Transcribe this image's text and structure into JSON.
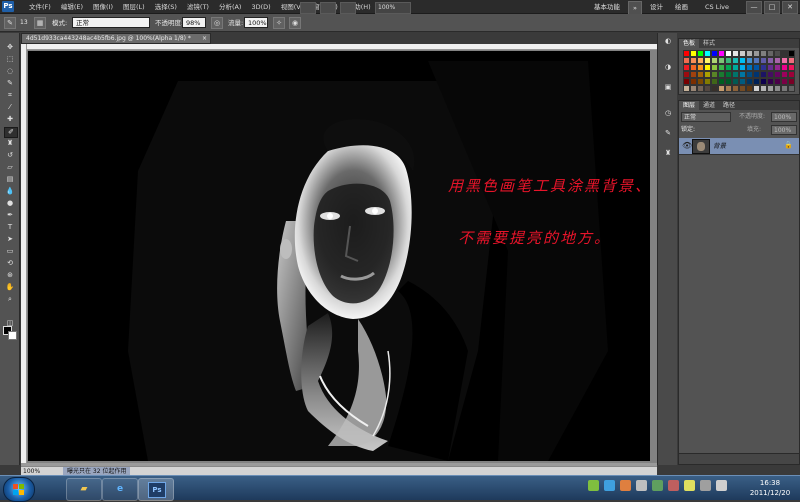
{
  "menubar": {
    "app_icon": "Ps",
    "menus": [
      "文件(F)",
      "编辑(E)",
      "图像(I)",
      "图层(L)",
      "选择(S)",
      "滤镜(T)",
      "分析(A)",
      "3D(D)",
      "视图(V)",
      "窗口(W)",
      "帮助(H)"
    ],
    "zoom": "100%",
    "workspaces": [
      "基本功能",
      "设计",
      "绘画"
    ],
    "workspace_more": "»",
    "cs_live": "CS Live",
    "window_buttons": [
      "—",
      "□",
      "✕"
    ]
  },
  "options": {
    "mode_label": "模式:",
    "mode_value": "正常",
    "opacity_label": "不透明度:",
    "opacity_value": "98%",
    "flow_label": "流量:",
    "flow_value": "100%",
    "brush_size": "13"
  },
  "document": {
    "tab_title": "4d51d933ca443248ac4b5fb6.jpg @ 100%(Alpha 1/8) *",
    "close": "×",
    "status_zoom": "100%",
    "status_text": "曝光只在 32 位起作用"
  },
  "canvas": {
    "annotation_line1": "用黑色画笔工具涂黑背景、服装等",
    "annotation_line2": "不需要提亮的地方。"
  },
  "panels": {
    "swatches_tabs": [
      "色板",
      "样式"
    ],
    "layers_tabs": [
      "图层",
      "通道",
      "路径"
    ],
    "blend_mode": "正常",
    "opacity_label": "不透明度:",
    "opacity_value": "100%",
    "lock_label": "锁定:",
    "fill_label": "填充:",
    "fill_value": "100%",
    "layer_name": "背景"
  },
  "taskbar": {
    "time": "16:38",
    "date": "2011/12/20",
    "ps_label": "Ps"
  },
  "swatch_colors": [
    "#ff0000",
    "#ffff00",
    "#00ff00",
    "#00ffff",
    "#0000ff",
    "#ff00ff",
    "#ffffff",
    "#e6e6e6",
    "#cccccc",
    "#b3b3b3",
    "#999999",
    "#808080",
    "#666666",
    "#4d4d4d",
    "#333333",
    "#000000",
    "#f26c4f",
    "#f68e56",
    "#fbaf5c",
    "#fff467",
    "#acd372",
    "#7cc576",
    "#3bb878",
    "#1abbb4",
    "#00bff3",
    "#438ccb",
    "#5574b9",
    "#605ca8",
    "#855fa8",
    "#a763a9",
    "#ef6ea8",
    "#f16d7e",
    "#ed1c24",
    "#f26522",
    "#f7941d",
    "#fff200",
    "#8dc63f",
    "#39b54a",
    "#00a651",
    "#00a99d",
    "#00aeef",
    "#0072bc",
    "#0054a6",
    "#2e3192",
    "#662d91",
    "#92278f",
    "#ec008c",
    "#ed145b",
    "#9e0b0f",
    "#a0410d",
    "#a36209",
    "#aba000",
    "#598527",
    "#1a7b30",
    "#007236",
    "#00746b",
    "#0076a3",
    "#004b80",
    "#003471",
    "#1b1464",
    "#440e62",
    "#630460",
    "#9e005d",
    "#9e0039",
    "#790000",
    "#7b2e00",
    "#7d4900",
    "#827b00",
    "#406618",
    "#005e20",
    "#005826",
    "#005952",
    "#005b7f",
    "#003663",
    "#002157",
    "#0d004c",
    "#32004b",
    "#4b0049",
    "#7b0046",
    "#7a0026",
    "#c7b299",
    "#998675",
    "#736357",
    "#534741",
    "#37302a",
    "#c69c6d",
    "#a67c52",
    "#8c6239",
    "#754c24",
    "#603913",
    "#d2d2d2",
    "#b4b4b4",
    "#a0a0a0",
    "#8c8c8c",
    "#787878",
    "#646464"
  ]
}
